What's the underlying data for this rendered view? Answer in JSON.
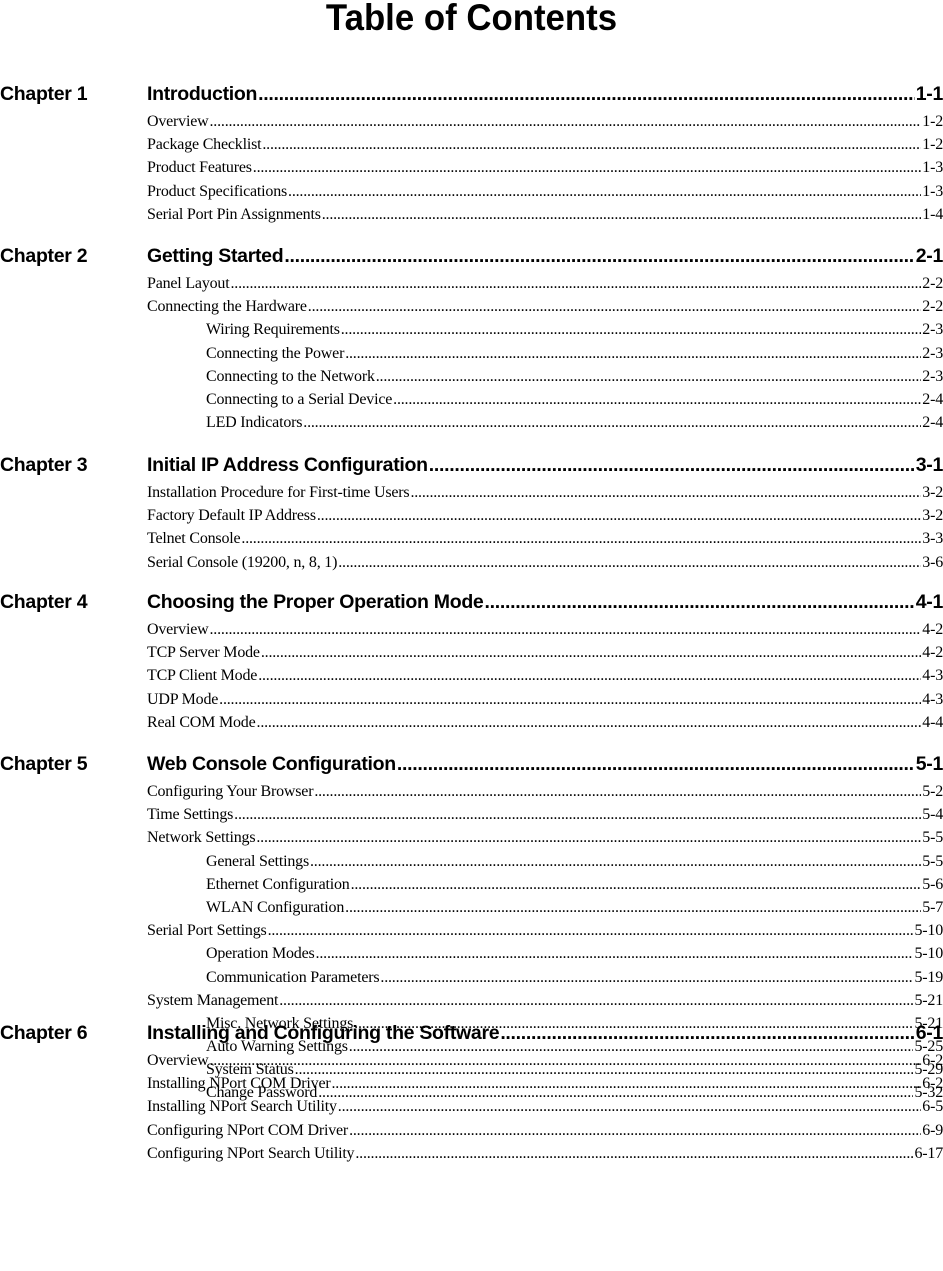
{
  "title": "Table of Contents",
  "chapters": [
    {
      "label": "Chapter 1",
      "title": "Introduction",
      "page": "1-1",
      "entries": [
        {
          "level": 1,
          "title": "Overview",
          "page": "1-2"
        },
        {
          "level": 1,
          "title": "Package Checklist",
          "page": "1-2"
        },
        {
          "level": 1,
          "title": "Product Features",
          "page": "1-3"
        },
        {
          "level": 1,
          "title": "Product Specifications",
          "page": "1-3"
        },
        {
          "level": 1,
          "title": "Serial Port Pin Assignments",
          "page": "1-4"
        }
      ]
    },
    {
      "label": "Chapter 2",
      "title": "Getting Started",
      "page": "2-1",
      "entries": [
        {
          "level": 1,
          "title": "Panel Layout",
          "page": "2-2"
        },
        {
          "level": 1,
          "title": "Connecting the Hardware",
          "page": "2-2"
        },
        {
          "level": 2,
          "title": "Wiring Requirements",
          "page": "2-3"
        },
        {
          "level": 2,
          "title": "Connecting the Power",
          "page": "2-3"
        },
        {
          "level": 2,
          "title": "Connecting to the Network",
          "page": "2-3"
        },
        {
          "level": 2,
          "title": "Connecting to a Serial Device",
          "page": "2-4"
        },
        {
          "level": 2,
          "title": "LED Indicators",
          "page": "2-4"
        }
      ]
    },
    {
      "label": "Chapter 3",
      "title": "Initial IP Address Configuration",
      "page": "3-1",
      "entries": [
        {
          "level": 1,
          "title": "Installation Procedure for First-time Users",
          "page": "3-2"
        },
        {
          "level": 1,
          "title": "Factory Default IP Address",
          "page": "3-2"
        },
        {
          "level": 1,
          "title": "Telnet Console",
          "page": "3-3"
        },
        {
          "level": 1,
          "title": "Serial Console (19200, n, 8, 1)",
          "page": "3-6"
        }
      ]
    },
    {
      "label": "Chapter 4",
      "title": "Choosing the Proper Operation Mode",
      "page": "4-1",
      "entries": [
        {
          "level": 1,
          "title": "Overview",
          "page": "4-2"
        },
        {
          "level": 1,
          "title": "TCP Server Mode",
          "page": "4-2"
        },
        {
          "level": 1,
          "title": "TCP Client Mode",
          "page": "4-3"
        },
        {
          "level": 1,
          "title": "UDP Mode",
          "page": "4-3"
        },
        {
          "level": 1,
          "title": "Real COM Mode",
          "page": "4-4"
        }
      ]
    },
    {
      "label": "Chapter 5",
      "title": "Web Console Configuration",
      "page": "5-1",
      "entries": [
        {
          "level": 1,
          "title": "Configuring Your Browser",
          "page": "5-2"
        },
        {
          "level": 1,
          "title": "Time Settings",
          "page": "5-4"
        },
        {
          "level": 1,
          "title": "Network Settings",
          "page": "5-5"
        },
        {
          "level": 2,
          "title": "General Settings",
          "page": "5-5"
        },
        {
          "level": 2,
          "title": "Ethernet Configuration",
          "page": "5-6"
        },
        {
          "level": 2,
          "title": "WLAN Configuration",
          "page": "5-7"
        },
        {
          "level": 1,
          "title": "Serial Port Settings",
          "page": "5-10"
        },
        {
          "level": 2,
          "title": "Operation Modes",
          "page": "5-10"
        },
        {
          "level": 2,
          "title": "Communication Parameters",
          "page": "5-19"
        },
        {
          "level": 1,
          "title": "System Management",
          "page": "5-21"
        },
        {
          "level": 2,
          "title": "Misc. Network Settings",
          "page": "5-21"
        },
        {
          "level": 2,
          "title": "Auto Warning Settings",
          "page": "5-25"
        },
        {
          "level": 2,
          "title": "System Status",
          "page": "5-29"
        },
        {
          "level": 2,
          "title": "Change Password",
          "page": "5-32"
        }
      ]
    },
    {
      "label": "Chapter 6",
      "title": "Installing and Configuring the Software",
      "page": "6-1",
      "entries": [
        {
          "level": 1,
          "title": "Overview",
          "page": "6-2"
        },
        {
          "level": 1,
          "title": "Installing NPort COM Driver",
          "page": "6-2"
        },
        {
          "level": 1,
          "title": "Installing NPort Search Utility",
          "page": "6-5"
        },
        {
          "level": 1,
          "title": "Configuring NPort COM Driver",
          "page": "6-9"
        },
        {
          "level": 1,
          "title": "Configuring NPort Search Utility",
          "page": "6-17"
        }
      ]
    }
  ]
}
